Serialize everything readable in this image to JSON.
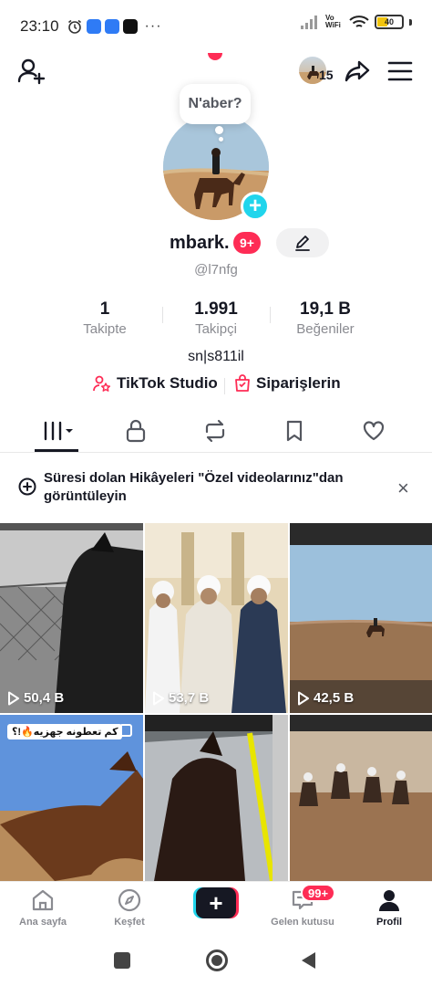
{
  "status_bar": {
    "time": "23:10",
    "battery": "40",
    "network": "Vo WiFi"
  },
  "header": {
    "friends_count": "15",
    "icons": [
      "add-user-icon",
      "share-icon",
      "menu-icon"
    ]
  },
  "profile": {
    "note": "N'aber?",
    "username": "mbark.",
    "name_badge": "9+",
    "handle": "@l7nfg",
    "bio": "sn|s811il",
    "stats": [
      {
        "value": "1",
        "label": "Takipte"
      },
      {
        "value": "1.991",
        "label": "Takipçi"
      },
      {
        "value": "19,1 B",
        "label": "Beğeniler"
      }
    ],
    "links": [
      {
        "label": "TikTok Studio",
        "icon": "person-star-icon"
      },
      {
        "label": "Siparişlerin",
        "icon": "shopping-bag-icon"
      }
    ]
  },
  "tabs": [
    {
      "name": "videos",
      "icon": "grid-icon",
      "active": true
    },
    {
      "name": "private",
      "icon": "lock-icon",
      "active": false
    },
    {
      "name": "reposts",
      "icon": "repost-icon",
      "active": false
    },
    {
      "name": "favorites",
      "icon": "bookmark-icon",
      "active": false
    },
    {
      "name": "liked",
      "icon": "heart-icon",
      "active": false
    }
  ],
  "banner": {
    "text": "Süresi dolan Hikâyeleri \"Özel videolarınız\"dan görüntüleyin"
  },
  "videos": [
    {
      "views": "50,4 B"
    },
    {
      "views": "53,7 B"
    },
    {
      "views": "42,5 B"
    },
    {
      "tag": "كم تعطونه جهزيه🔥!؟"
    },
    {},
    {}
  ],
  "bottom_nav": [
    {
      "label": "Ana sayfa",
      "icon": "home-icon"
    },
    {
      "label": "Keşfet",
      "icon": "compass-icon"
    },
    {
      "label": "",
      "icon": "plus-icon"
    },
    {
      "label": "Gelen kutusu",
      "icon": "inbox-icon",
      "badge": "99+"
    },
    {
      "label": "Profil",
      "icon": "profile-icon",
      "active": true
    }
  ],
  "colors": {
    "accent": "#fe2c55",
    "cyan": "#20d5ec",
    "text": "#161823",
    "muted": "#8a8b91"
  }
}
